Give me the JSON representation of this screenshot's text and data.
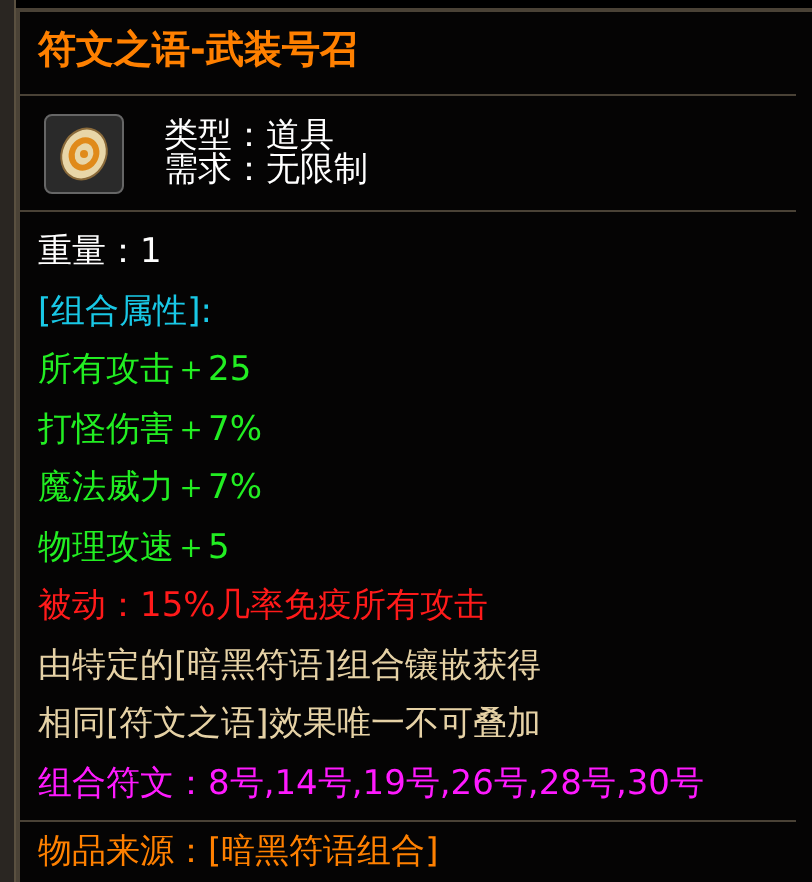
{
  "tooltip": {
    "title": "符文之语-武装号召",
    "type_line": "类型：道具",
    "requirement_line": "需求：无限制",
    "weight": "重量：1",
    "attributes_header": "[组合属性]:",
    "attributes": [
      "所有攻击＋25",
      "打怪伤害＋7%",
      "魔法威力＋7%",
      "物理攻速＋5"
    ],
    "passive": "被动：15%几率免疫所有攻击",
    "notes": [
      "由特定的[暗黑符语]组合镶嵌获得",
      "相同[符文之语]效果唯一不可叠加"
    ],
    "combo_runes": "组合符文：8号,14号,19号,26号,28号,30号",
    "source": "物品来源：[暗黑符语组合]"
  }
}
